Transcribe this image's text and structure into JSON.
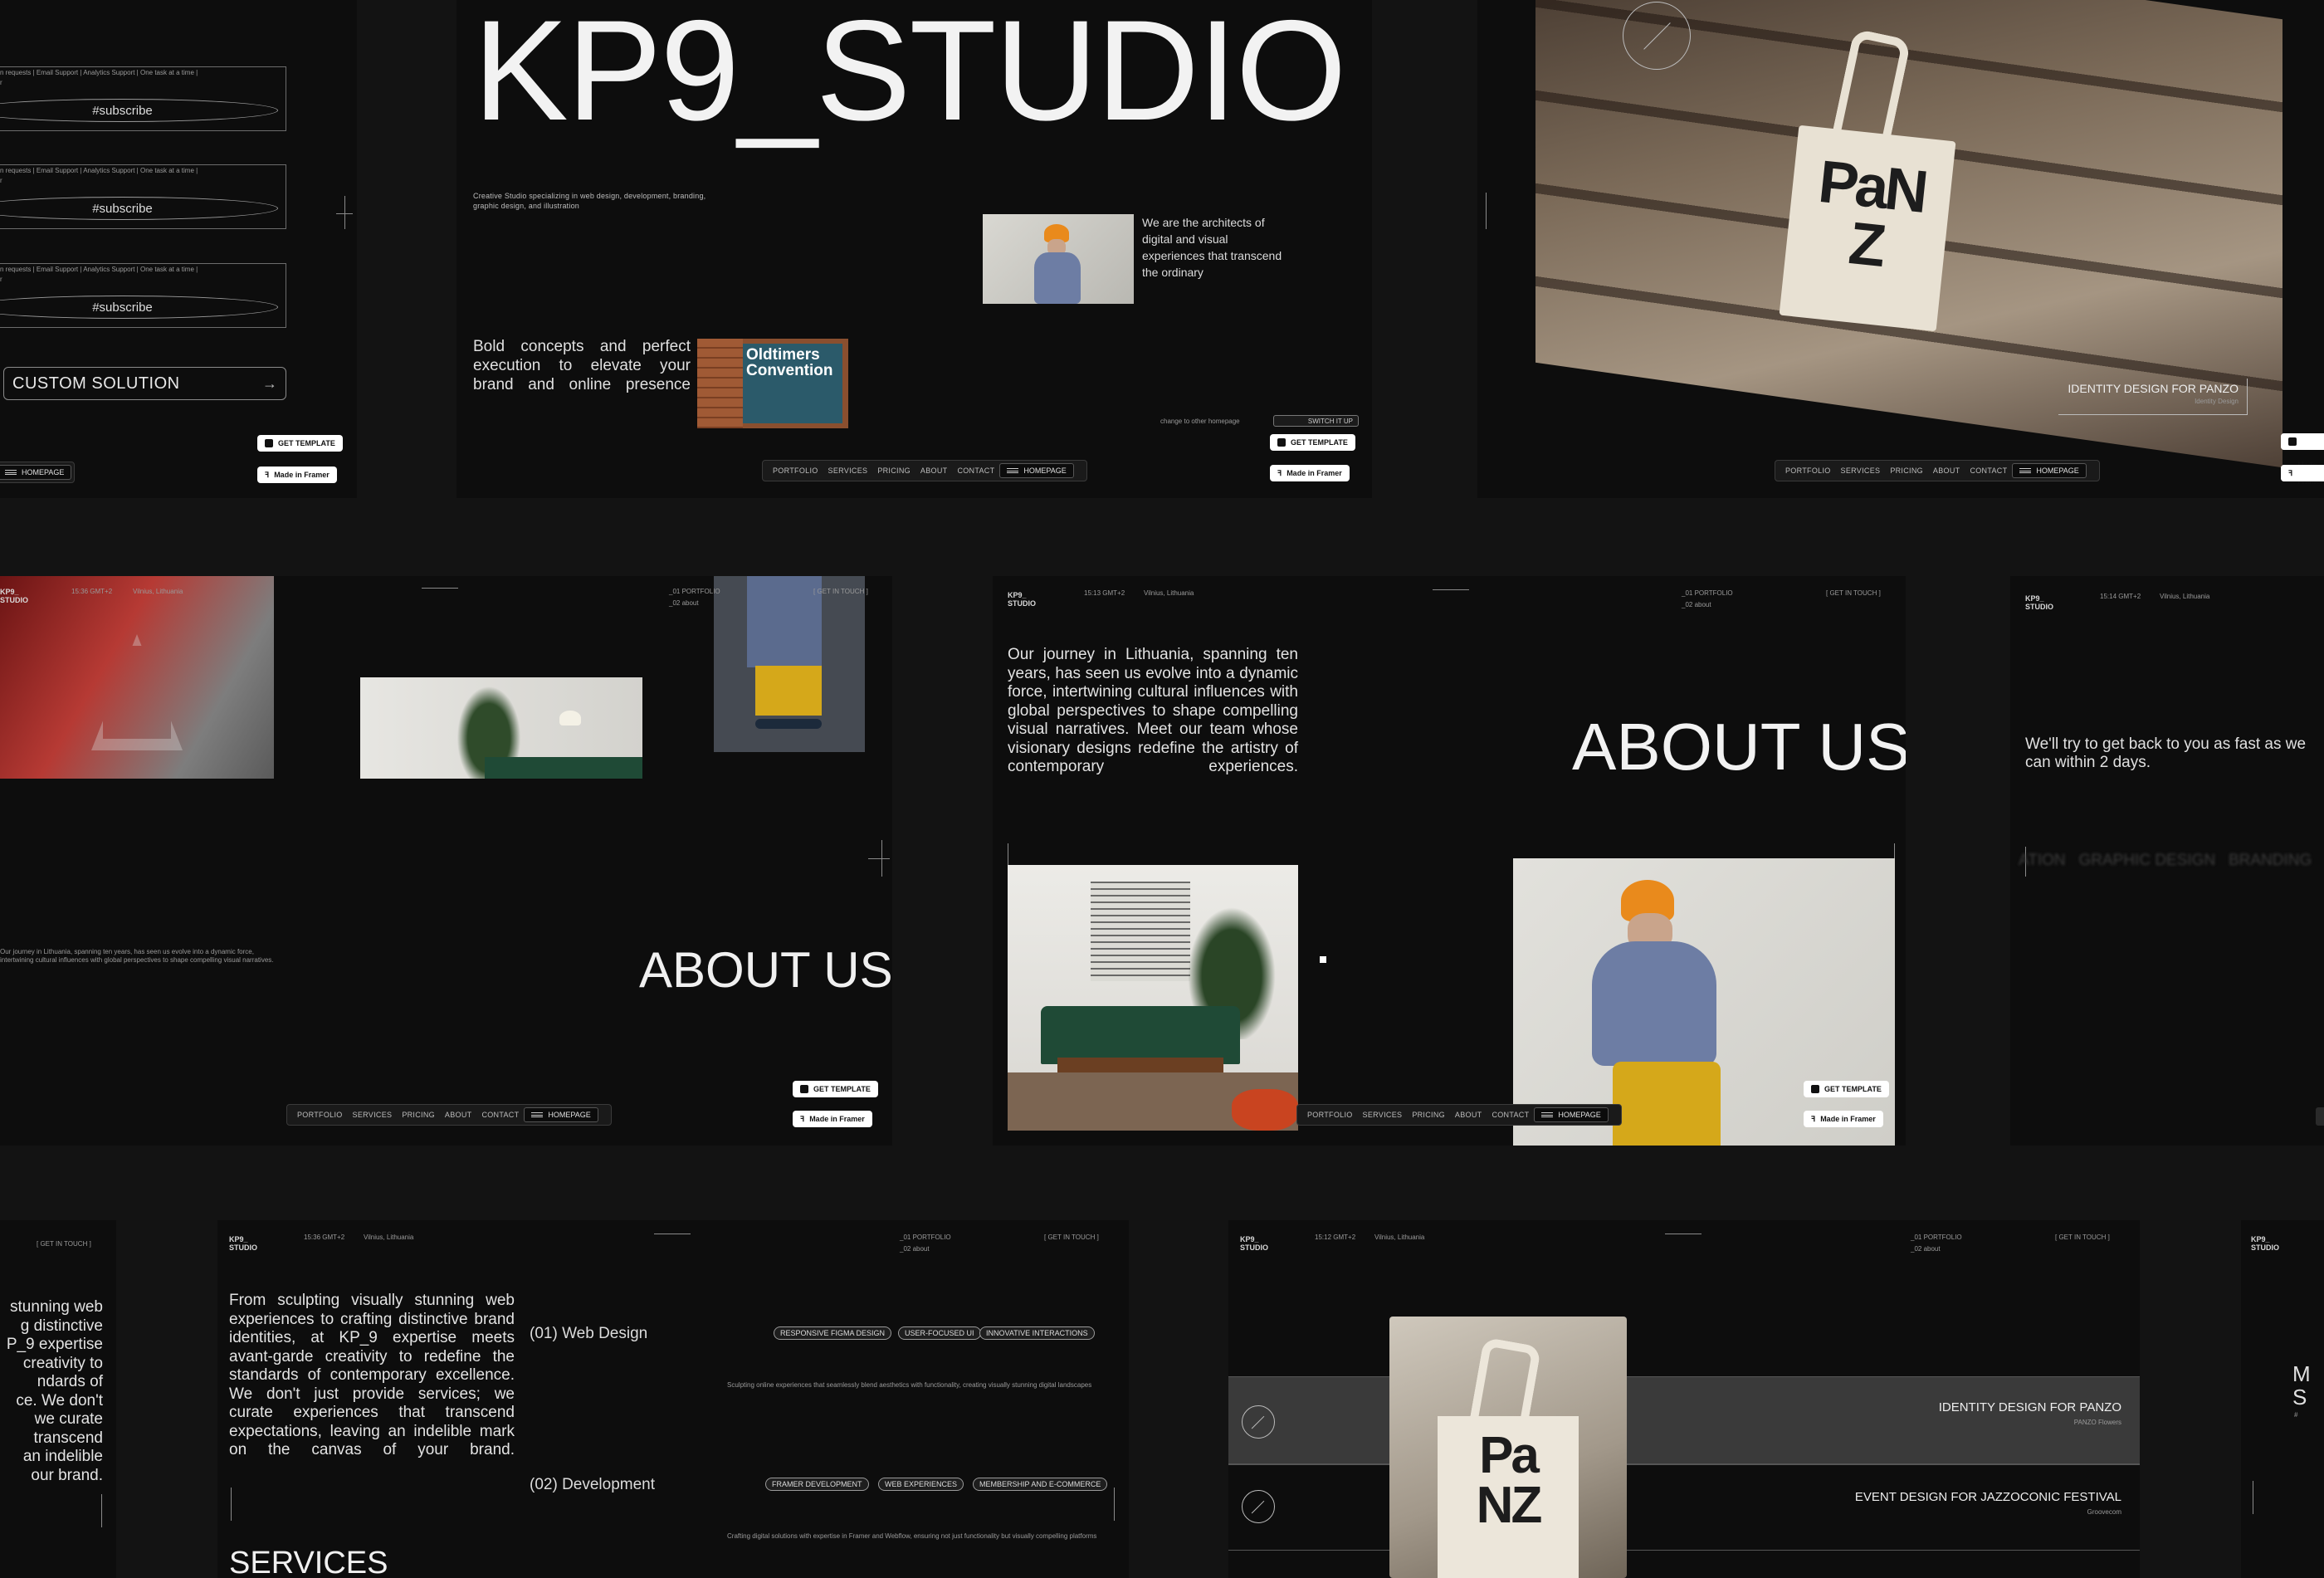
{
  "common": {
    "get_template": "GET TEMPLATE",
    "made_in_framer": "Made in Framer",
    "homepage": "HOMEPAGE",
    "nav": [
      "PORTFOLIO",
      "SERVICES",
      "PRICING",
      "ABOUT",
      "CONTACT"
    ],
    "brand": "KP9_\nSTUDIO",
    "get_in_touch": "[ GET IN TOUCH ]",
    "menu_portfolio": "_01  PORTFOLIO",
    "menu_about": "_02  about"
  },
  "pricing_panel": {
    "plan_text": "n requests | Email Support | Analytics Support | One task at a time |",
    "plan_text_cont": "r",
    "subscribe_label": "#subscribe",
    "custom_solution": "CUSTOM SOLUTION",
    "arrow": "→"
  },
  "hero_panel": {
    "title": "KP9_STUDIO",
    "description": "Creative Studio specializing in web design, development, branding, graphic design, and illustration",
    "architects": "We are the architects of digital and visual experiences that transcend the ordinary",
    "bold_concepts": "Bold concepts and perfect execution to elevate your brand and online presence",
    "poster_text": "Oldtimers Convention",
    "change_homepage": "change to other homepage",
    "switch_it_up": "SWITCH IT UP"
  },
  "identity_panel": {
    "caption": "IDENTITY DESIGN FOR PANZO",
    "sub": "Identity Design",
    "bag_text": "PaNZ"
  },
  "about_panel_left": {
    "time": "15:36 GMT+2",
    "location": "Vilnius, Lithuania",
    "heading": "ABOUT US",
    "blurb": "Our journey in Lithuania, spanning ten years, has seen us evolve into a dynamic force, intertwining cultural influences with global perspectives to shape compelling visual narratives."
  },
  "about_panel_center": {
    "time": "15:13 GMT+2",
    "location": "Vilnius, Lithuania",
    "heading": "ABOUT US",
    "paragraph": "Our journey in Lithuania, spanning ten years, has seen us evolve into a dynamic force, intertwining cultural influences with global perspectives to shape compelling visual narratives. Meet our team whose visionary designs redefine the artistry of contemporary experiences."
  },
  "contact_panel": {
    "time": "15:14 GMT+2",
    "location": "Vilnius, Lithuania",
    "message": "We'll try to get back to you as fast as we can within 2 days.",
    "ticker": "ATION   GRAPHIC DESIGN   BRANDING"
  },
  "services_panel": {
    "time": "15:36 GMT+2",
    "location": "Vilnius, Lithuania",
    "intro": "From sculpting visually stunning web experiences to crafting distinctive brand identities, at KP_9 expertise meets avant-garde creativity to redefine the standards of contemporary excellence. We don't just provide services; we curate experiences that transcend expectations, leaving an indelible mark on the canvas of your brand.",
    "heading": "SERVICES",
    "services": [
      {
        "title": "(01) Web Design",
        "tags": [
          "RESPONSIVE FIGMA DESIGN",
          "USER-FOCUSED UI",
          "INNOVATIVE INTERACTIONS"
        ],
        "desc": "Sculpting online experiences that seamlessly blend aesthetics with functionality, creating visually stunning digital landscapes"
      },
      {
        "title": "(02) Development",
        "tags": [
          "FRAMER DEVELOPMENT",
          "WEB EXPERIENCES",
          "MEMBERSHIP AND E-COMMERCE"
        ],
        "desc": "Crafting digital solutions with expertise in Framer and Webflow, ensuring not just functionality but visually compelling platforms"
      }
    ]
  },
  "services_left_fragment": {
    "lines": [
      "stunning web",
      "g distinctive",
      "P_9 expertise",
      "creativity to",
      "ndards of",
      "ce. We don't",
      "we curate",
      "transcend",
      "an indelible",
      "our brand."
    ]
  },
  "portfolio_panel": {
    "time": "15:12 GMT+2",
    "location": "Vilnius, Lithuania",
    "projects": [
      {
        "title": "IDENTITY DESIGN FOR PANZO",
        "sub": "PANZO Flowers"
      },
      {
        "title": "EVENT DESIGN FOR JAZZOCONIC FESTIVAL",
        "sub": "Groovecom"
      }
    ]
  },
  "right_fragment": {
    "hash": "#"
  },
  "colors": {
    "background": "#131313",
    "panel": "#0d0d0d",
    "text": "#e9e9e9",
    "orange": "#e98a1c",
    "mustard": "#d5a81a",
    "green_sofa": "#1f4a36"
  }
}
